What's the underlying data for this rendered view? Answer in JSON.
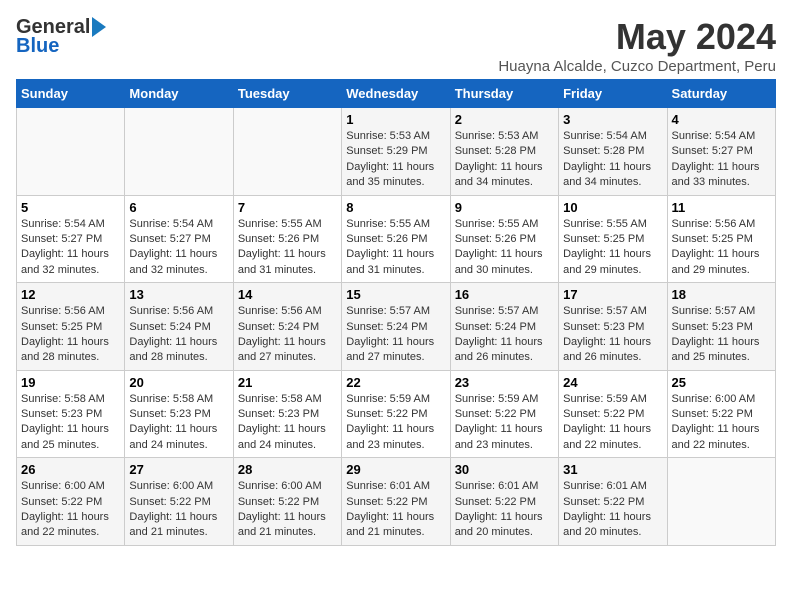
{
  "logo": {
    "general": "General",
    "blue": "Blue"
  },
  "header": {
    "month": "May 2024",
    "location": "Huayna Alcalde, Cuzco Department, Peru"
  },
  "days_of_week": [
    "Sunday",
    "Monday",
    "Tuesday",
    "Wednesday",
    "Thursday",
    "Friday",
    "Saturday"
  ],
  "weeks": [
    [
      {
        "day": "",
        "info": ""
      },
      {
        "day": "",
        "info": ""
      },
      {
        "day": "",
        "info": ""
      },
      {
        "day": "1",
        "info": "Sunrise: 5:53 AM\nSunset: 5:29 PM\nDaylight: 11 hours and 35 minutes."
      },
      {
        "day": "2",
        "info": "Sunrise: 5:53 AM\nSunset: 5:28 PM\nDaylight: 11 hours and 34 minutes."
      },
      {
        "day": "3",
        "info": "Sunrise: 5:54 AM\nSunset: 5:28 PM\nDaylight: 11 hours and 34 minutes."
      },
      {
        "day": "4",
        "info": "Sunrise: 5:54 AM\nSunset: 5:27 PM\nDaylight: 11 hours and 33 minutes."
      }
    ],
    [
      {
        "day": "5",
        "info": "Sunrise: 5:54 AM\nSunset: 5:27 PM\nDaylight: 11 hours and 32 minutes."
      },
      {
        "day": "6",
        "info": "Sunrise: 5:54 AM\nSunset: 5:27 PM\nDaylight: 11 hours and 32 minutes."
      },
      {
        "day": "7",
        "info": "Sunrise: 5:55 AM\nSunset: 5:26 PM\nDaylight: 11 hours and 31 minutes."
      },
      {
        "day": "8",
        "info": "Sunrise: 5:55 AM\nSunset: 5:26 PM\nDaylight: 11 hours and 31 minutes."
      },
      {
        "day": "9",
        "info": "Sunrise: 5:55 AM\nSunset: 5:26 PM\nDaylight: 11 hours and 30 minutes."
      },
      {
        "day": "10",
        "info": "Sunrise: 5:55 AM\nSunset: 5:25 PM\nDaylight: 11 hours and 29 minutes."
      },
      {
        "day": "11",
        "info": "Sunrise: 5:56 AM\nSunset: 5:25 PM\nDaylight: 11 hours and 29 minutes."
      }
    ],
    [
      {
        "day": "12",
        "info": "Sunrise: 5:56 AM\nSunset: 5:25 PM\nDaylight: 11 hours and 28 minutes."
      },
      {
        "day": "13",
        "info": "Sunrise: 5:56 AM\nSunset: 5:24 PM\nDaylight: 11 hours and 28 minutes."
      },
      {
        "day": "14",
        "info": "Sunrise: 5:56 AM\nSunset: 5:24 PM\nDaylight: 11 hours and 27 minutes."
      },
      {
        "day": "15",
        "info": "Sunrise: 5:57 AM\nSunset: 5:24 PM\nDaylight: 11 hours and 27 minutes."
      },
      {
        "day": "16",
        "info": "Sunrise: 5:57 AM\nSunset: 5:24 PM\nDaylight: 11 hours and 26 minutes."
      },
      {
        "day": "17",
        "info": "Sunrise: 5:57 AM\nSunset: 5:23 PM\nDaylight: 11 hours and 26 minutes."
      },
      {
        "day": "18",
        "info": "Sunrise: 5:57 AM\nSunset: 5:23 PM\nDaylight: 11 hours and 25 minutes."
      }
    ],
    [
      {
        "day": "19",
        "info": "Sunrise: 5:58 AM\nSunset: 5:23 PM\nDaylight: 11 hours and 25 minutes."
      },
      {
        "day": "20",
        "info": "Sunrise: 5:58 AM\nSunset: 5:23 PM\nDaylight: 11 hours and 24 minutes."
      },
      {
        "day": "21",
        "info": "Sunrise: 5:58 AM\nSunset: 5:23 PM\nDaylight: 11 hours and 24 minutes."
      },
      {
        "day": "22",
        "info": "Sunrise: 5:59 AM\nSunset: 5:22 PM\nDaylight: 11 hours and 23 minutes."
      },
      {
        "day": "23",
        "info": "Sunrise: 5:59 AM\nSunset: 5:22 PM\nDaylight: 11 hours and 23 minutes."
      },
      {
        "day": "24",
        "info": "Sunrise: 5:59 AM\nSunset: 5:22 PM\nDaylight: 11 hours and 22 minutes."
      },
      {
        "day": "25",
        "info": "Sunrise: 6:00 AM\nSunset: 5:22 PM\nDaylight: 11 hours and 22 minutes."
      }
    ],
    [
      {
        "day": "26",
        "info": "Sunrise: 6:00 AM\nSunset: 5:22 PM\nDaylight: 11 hours and 22 minutes."
      },
      {
        "day": "27",
        "info": "Sunrise: 6:00 AM\nSunset: 5:22 PM\nDaylight: 11 hours and 21 minutes."
      },
      {
        "day": "28",
        "info": "Sunrise: 6:00 AM\nSunset: 5:22 PM\nDaylight: 11 hours and 21 minutes."
      },
      {
        "day": "29",
        "info": "Sunrise: 6:01 AM\nSunset: 5:22 PM\nDaylight: 11 hours and 21 minutes."
      },
      {
        "day": "30",
        "info": "Sunrise: 6:01 AM\nSunset: 5:22 PM\nDaylight: 11 hours and 20 minutes."
      },
      {
        "day": "31",
        "info": "Sunrise: 6:01 AM\nSunset: 5:22 PM\nDaylight: 11 hours and 20 minutes."
      },
      {
        "day": "",
        "info": ""
      }
    ]
  ]
}
